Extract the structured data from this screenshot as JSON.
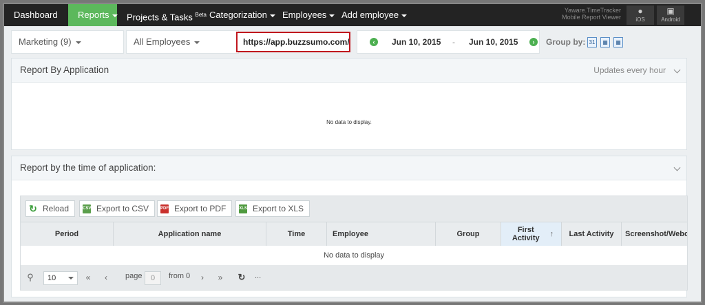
{
  "nav": {
    "items": [
      {
        "label": "Dashboard"
      },
      {
        "label": "Reports"
      },
      {
        "label": "Projects & Tasks",
        "badge": "Beta"
      },
      {
        "label": "Categorization"
      },
      {
        "label": "Employees"
      },
      {
        "label": "Add employee"
      }
    ],
    "mobile_title_1": "Yaware.TimeTracker",
    "mobile_title_2": "Mobile Report Viewer",
    "ios_label": "iOS",
    "android_label": "Android",
    "active_color": "#5cb85c"
  },
  "filters": {
    "department": "Marketing (9)",
    "employees": "All Employees",
    "url": "https://app.buzzsumo.com/",
    "date_from": "Jun 10, 2015",
    "date_separator": "-",
    "date_to": "Jun 10, 2015",
    "group_by_label": "Group by:",
    "calendar_day": "31"
  },
  "panel1": {
    "title": "Report By Application",
    "updates": "Updates every hour",
    "empty": "No data to display."
  },
  "panel2": {
    "title": "Report by the time of application:",
    "toolbar": {
      "reload": "Reload",
      "csv": "Export to CSV",
      "pdf": "Export to PDF",
      "xls": "Export to XLS"
    },
    "columns": [
      "Period",
      "Application name",
      "Time",
      "Employee",
      "Group",
      "First Activity",
      "Last Activity",
      "Screenshot/Webc"
    ],
    "empty": "No data to display",
    "pager": {
      "page_size": "10",
      "page_label": "page",
      "page_value": "0",
      "from_label": "from 0",
      "ellipsis": "..."
    }
  }
}
